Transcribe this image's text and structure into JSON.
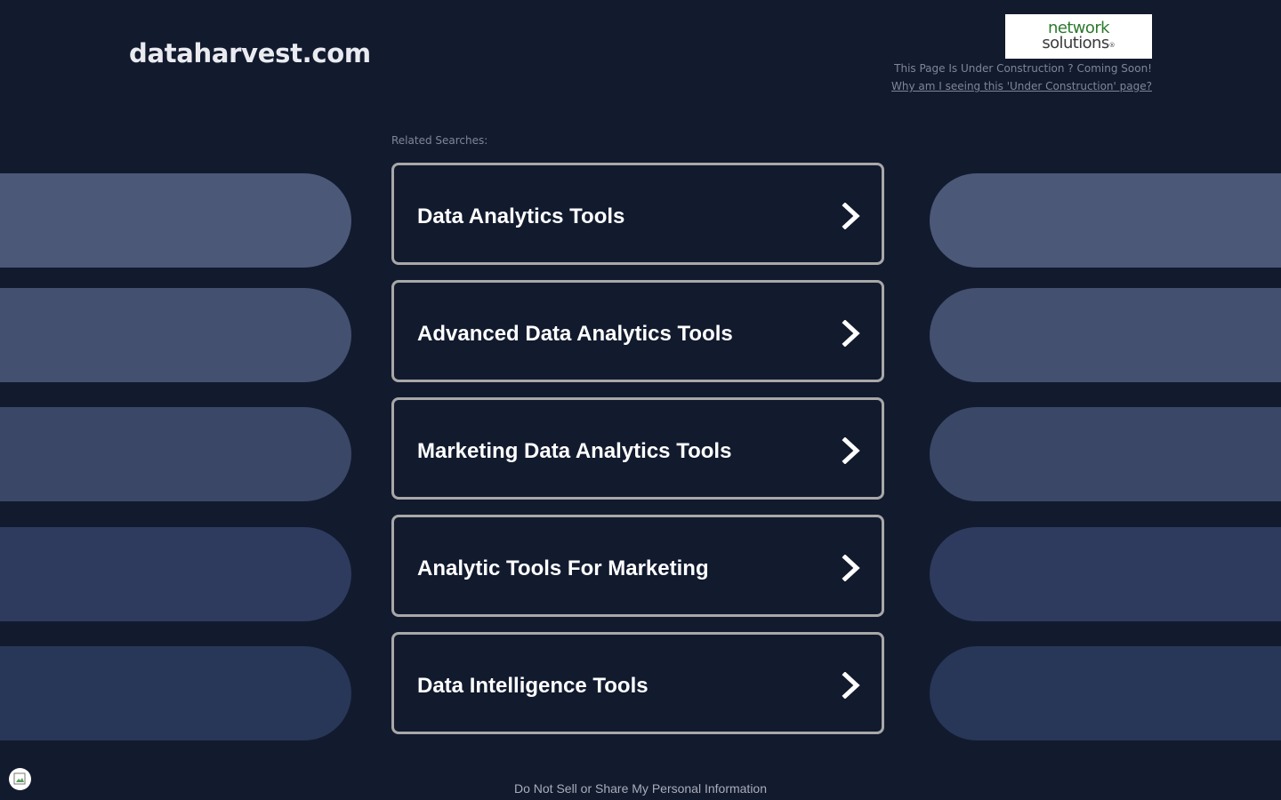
{
  "header": {
    "domain": "dataharvest.com",
    "logo": {
      "line1": "network",
      "line2": "solutions",
      "reg_mark": "®"
    },
    "construction_notice": "This Page Is Under Construction ? Coming Soon!",
    "why_link": "Why am I seeing this 'Under Construction' page?"
  },
  "related": {
    "label": "Related Searches:",
    "items": [
      {
        "label": "Data Analytics Tools",
        "icon": "chevron-right-icon"
      },
      {
        "label": "Advanced Data Analytics Tools",
        "icon": "chevron-right-icon"
      },
      {
        "label": "Marketing Data Analytics Tools",
        "icon": "chevron-right-icon"
      },
      {
        "label": "Analytic Tools For Marketing",
        "icon": "chevron-right-icon"
      },
      {
        "label": "Data Intelligence Tools",
        "icon": "chevron-right-icon"
      }
    ]
  },
  "decorative_pill_colors": [
    "#4b5877",
    "#435070",
    "#3a4766",
    "#2e3b5e",
    "#283658"
  ],
  "colors": {
    "background": "#121a2e",
    "card_border": "#a8a8a8",
    "logo_green": "#2c7a2e"
  },
  "footer": {
    "privacy_link": "Do Not Sell or Share My Personal Information"
  }
}
